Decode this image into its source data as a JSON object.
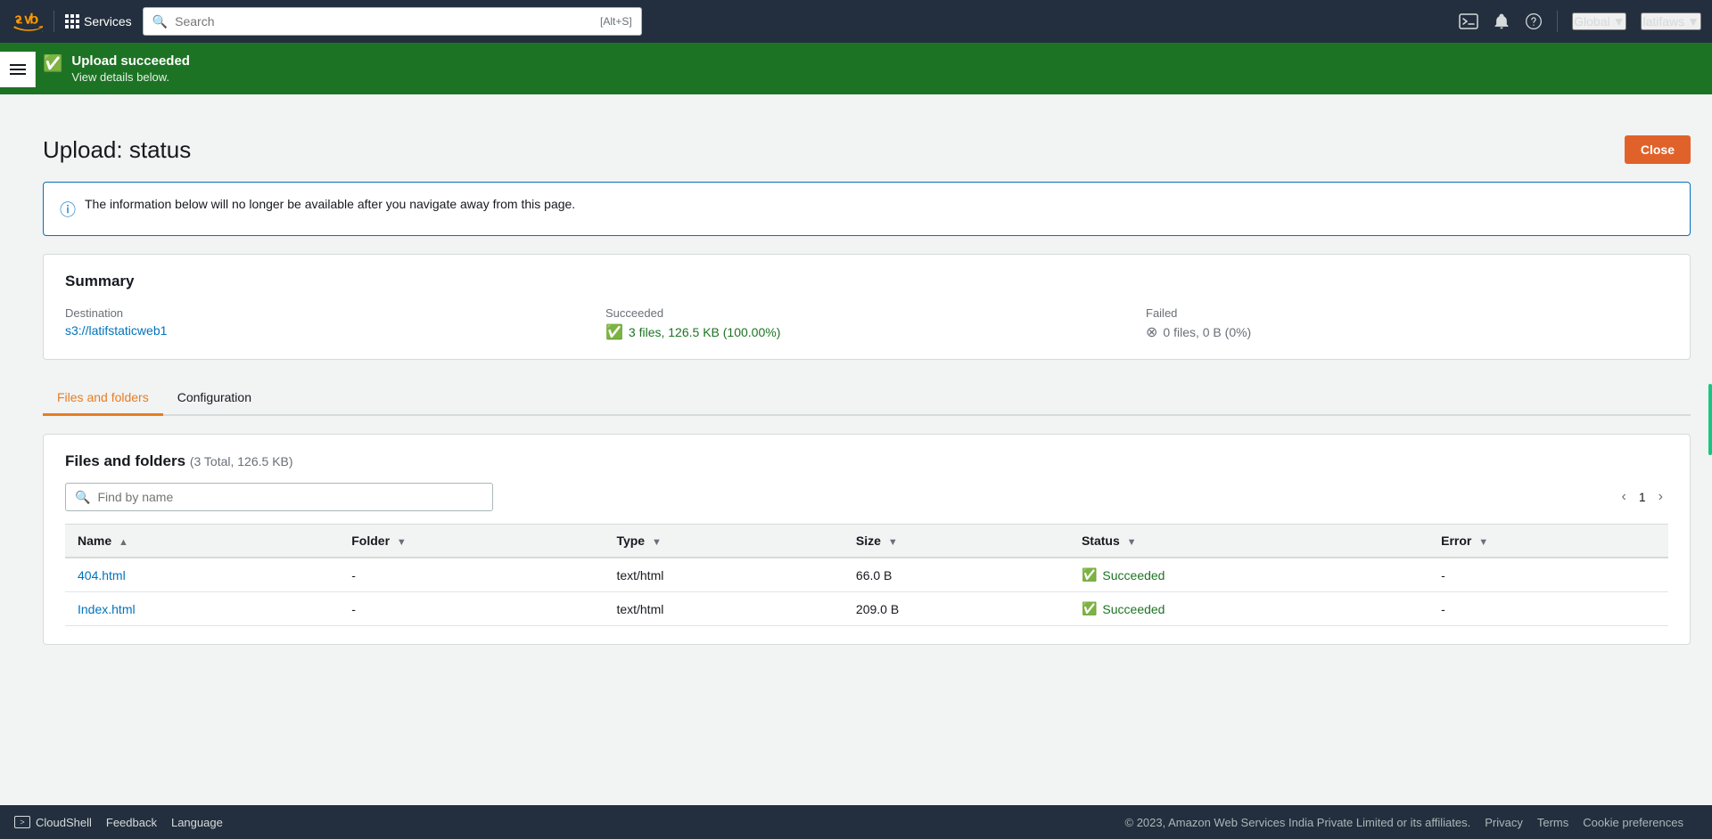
{
  "nav": {
    "services_label": "Services",
    "search_placeholder": "Search",
    "search_shortcut": "[Alt+S]",
    "region_label": "Global",
    "user_label": "latifaws"
  },
  "success_banner": {
    "title": "Upload succeeded",
    "subtitle": "View details below."
  },
  "page": {
    "title": "Upload: status",
    "close_button": "Close"
  },
  "info_box": {
    "text": "The information below will no longer be available after you navigate away from this page."
  },
  "summary": {
    "title": "Summary",
    "destination_label": "Destination",
    "destination_value": "s3://latifstaticweb1",
    "succeeded_label": "Succeeded",
    "succeeded_value": "3 files, 126.5 KB (100.00%)",
    "failed_label": "Failed",
    "failed_value": "0 files, 0 B (0%)"
  },
  "tabs": [
    {
      "id": "files-folders",
      "label": "Files and folders",
      "active": true
    },
    {
      "id": "configuration",
      "label": "Configuration",
      "active": false
    }
  ],
  "files_section": {
    "title": "Files and folders",
    "count_info": "(3 Total, 126.5 KB)",
    "search_placeholder": "Find by name",
    "page_current": "1"
  },
  "table": {
    "columns": [
      {
        "id": "name",
        "label": "Name",
        "sortable": true
      },
      {
        "id": "folder",
        "label": "Folder",
        "sortable": true
      },
      {
        "id": "type",
        "label": "Type",
        "sortable": true
      },
      {
        "id": "size",
        "label": "Size",
        "sortable": true
      },
      {
        "id": "status",
        "label": "Status",
        "sortable": true
      },
      {
        "id": "error",
        "label": "Error",
        "sortable": true
      }
    ],
    "rows": [
      {
        "name": "404.html",
        "folder": "-",
        "type": "text/html",
        "size": "66.0 B",
        "status": "Succeeded",
        "error": "-"
      },
      {
        "name": "Index.html",
        "folder": "-",
        "type": "text/html",
        "size": "209.0 B",
        "status": "Succeeded",
        "error": ""
      }
    ]
  },
  "bottom_bar": {
    "cloudshell_label": "CloudShell",
    "feedback_label": "Feedback",
    "language_label": "Language",
    "copyright": "© 2023, Amazon Web Services India Private Limited or its affiliates.",
    "privacy_label": "Privacy",
    "terms_label": "Terms",
    "cookie_label": "Cookie preferences"
  }
}
